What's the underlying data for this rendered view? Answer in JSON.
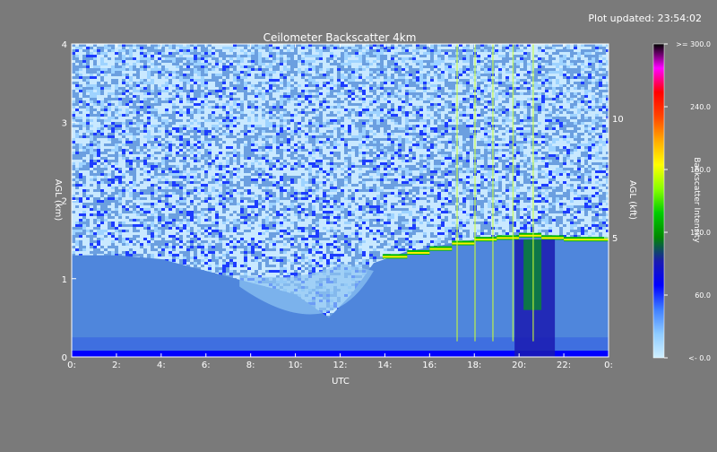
{
  "header": {
    "plot_updated": "Plot updated: 23:54:02"
  },
  "chart_data": {
    "type": "heatmap",
    "title": "Ceilometer Backscatter 4km",
    "xlabel": "UTC",
    "ylabel_left": "AGL (km)",
    "ylabel_right": "AGL (kft)",
    "xlim": [
      0,
      24
    ],
    "ylim_km": [
      0,
      4
    ],
    "x_ticks": [
      0,
      2,
      4,
      6,
      8,
      10,
      12,
      14,
      16,
      18,
      20,
      22,
      24
    ],
    "x_tick_labels": [
      "0:",
      "2:",
      "4:",
      "6:",
      "8:",
      "10:",
      "12:",
      "14:",
      "16:",
      "18:",
      "20:",
      "22:",
      "0:"
    ],
    "y_ticks_km": [
      0,
      1,
      2,
      3,
      4
    ],
    "y_tick_labels_km": [
      "0",
      "1",
      "2",
      "3",
      "4"
    ],
    "y_ticks_kft": [
      5,
      10
    ],
    "y_tick_labels_kft": [
      "5",
      "10"
    ],
    "colorbar": {
      "label": "Backscatter Intensity",
      "range": [
        0,
        300
      ],
      "ticks": [
        0,
        60,
        120,
        180,
        240,
        300
      ],
      "tick_labels": [
        "<-   0.0",
        "60.0",
        "120.0",
        "180.0",
        "240.0",
        ">= 300.0"
      ],
      "colors": [
        "#cfefff",
        "#8ecbff",
        "#3f7fff",
        "#0000ff",
        "#1a1ab0",
        "#008800",
        "#00cc00",
        "#88ff00",
        "#ffff00",
        "#ffaa00",
        "#ff4400",
        "#ff0000",
        "#ff00ff",
        "#000000"
      ]
    },
    "features": {
      "noise_background_color": "#6b9fe0",
      "surface_layer_top_km": 0.25,
      "boundary_layer_top_km": [
        [
          0,
          1.3
        ],
        [
          2,
          1.3
        ],
        [
          4,
          1.25
        ],
        [
          6,
          1.1
        ],
        [
          8,
          0.95
        ],
        [
          10,
          0.8
        ],
        [
          11.5,
          0.5
        ],
        [
          12.5,
          0.8
        ],
        [
          13.5,
          1.2
        ],
        [
          15,
          1.35
        ],
        [
          17,
          1.45
        ],
        [
          19,
          1.55
        ],
        [
          21,
          1.55
        ],
        [
          23,
          1.5
        ],
        [
          24,
          1.5
        ]
      ],
      "cloud_layer_km": [
        [
          13.9,
          1.28
        ],
        [
          15,
          1.33
        ],
        [
          16,
          1.38
        ],
        [
          17,
          1.45
        ],
        [
          18,
          1.5
        ],
        [
          19,
          1.52
        ],
        [
          20,
          1.55
        ],
        [
          21,
          1.52
        ],
        [
          22,
          1.5
        ],
        [
          23,
          1.5
        ],
        [
          24,
          1.5
        ]
      ],
      "precip_streak_hours": [
        17.2,
        18.0,
        18.8,
        19.7,
        20.6
      ]
    }
  }
}
